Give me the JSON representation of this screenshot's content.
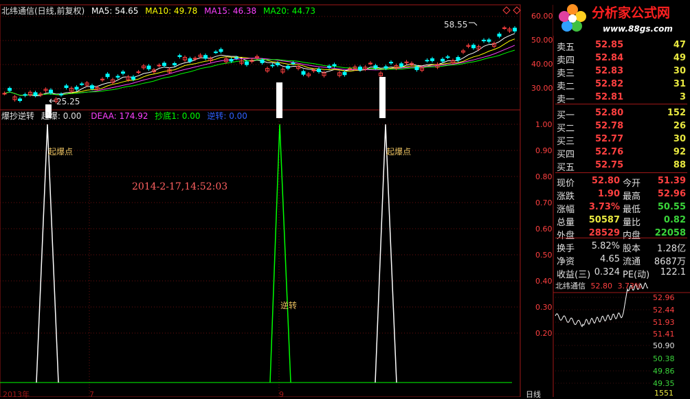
{
  "main_header": {
    "title": "北纬通信(日线,前复权)",
    "ma5": "MA5: 54.65",
    "ma10": "MA10: 49.78",
    "ma15": "MA15: 46.38",
    "ma20": "MA20: 44.73"
  },
  "sub_header": {
    "title": "爆抄逆转",
    "qibao": "起爆: 0.00",
    "deaa": "DEAA: 174.92",
    "chaodi": "抄底1: 0.00",
    "nizhuan": "逆转: 0.00"
  },
  "price_axis": [
    "60.00",
    "50.00",
    "40.00",
    "30.00"
  ],
  "indicator_axis": [
    "1.00",
    "0.90",
    "0.80",
    "0.70",
    "0.60",
    "0.50",
    "0.40",
    "0.30",
    "0.20"
  ],
  "annotations": {
    "high": "58.55",
    "low": "25.25",
    "qibao1": "起爆点",
    "qibao2": "起爆点",
    "nizhuan": "逆转",
    "timestamp": "2014-2-17,14:52:03"
  },
  "x_axis": {
    "left": "2013年",
    "mid1": "7",
    "mid2": "9",
    "right": "日线"
  },
  "logo": {
    "name": "分析家公式网",
    "url": "www.88gs.com"
  },
  "order_book": {
    "asks": [
      {
        "label": "卖五",
        "price": "52.85",
        "vol": "47"
      },
      {
        "label": "卖四",
        "price": "52.84",
        "vol": "49"
      },
      {
        "label": "卖三",
        "price": "52.83",
        "vol": "30"
      },
      {
        "label": "卖二",
        "price": "52.82",
        "vol": "31"
      },
      {
        "label": "卖一",
        "price": "52.81",
        "vol": "3"
      }
    ],
    "bids": [
      {
        "label": "买一",
        "price": "52.80",
        "vol": "152"
      },
      {
        "label": "买二",
        "price": "52.78",
        "vol": "26"
      },
      {
        "label": "买三",
        "price": "52.77",
        "vol": "30"
      },
      {
        "label": "买四",
        "price": "52.76",
        "vol": "92"
      },
      {
        "label": "买五",
        "price": "52.75",
        "vol": "88"
      }
    ]
  },
  "quote": [
    {
      "l1": "现价",
      "v1": "52.80",
      "c1": "#ff4040",
      "l2": "今开",
      "v2": "51.39",
      "c2": "#ff4040"
    },
    {
      "l1": "涨跌",
      "v1": "1.90",
      "c1": "#ff4040",
      "l2": "最高",
      "v2": "52.96",
      "c2": "#ff4040"
    },
    {
      "l1": "涨幅",
      "v1": "3.73%",
      "c1": "#ff4040",
      "l2": "最低",
      "v2": "50.55",
      "c2": "#3ad43a"
    },
    {
      "l1": "总量",
      "v1": "50587",
      "c1": "#e8e840",
      "l2": "量比",
      "v2": "0.82",
      "c2": "#3ad43a"
    },
    {
      "l1": "外盘",
      "v1": "28529",
      "c1": "#ff4040",
      "l2": "内盘",
      "v2": "22058",
      "c2": "#3ad43a"
    }
  ],
  "fundamentals": [
    {
      "l1": "换手",
      "v1": "5.82%",
      "l2": "股本",
      "v2": "1.28亿"
    },
    {
      "l1": "净资",
      "v1": "4.65",
      "l2": "流通",
      "v2": "8687万"
    },
    {
      "l1": "收益(三)",
      "v1": "0.324",
      "l2": "PE(动)",
      "v2": "122.1"
    }
  ],
  "mini_chart": {
    "name": "北纬通信",
    "price": "52.80",
    "pct": "3.73%",
    "axis": [
      "52.96",
      "52.44",
      "51.93",
      "51.41",
      "50.90",
      "50.38",
      "49.86",
      "49.35"
    ],
    "bottom": "1551"
  },
  "colors": {
    "up": "#ff4040",
    "down": "#00ffff",
    "ma5": "#ffffff",
    "ma10": "#ffff00",
    "ma15": "#ff40ff",
    "ma20": "#00ff00",
    "grid": "#801010"
  }
}
